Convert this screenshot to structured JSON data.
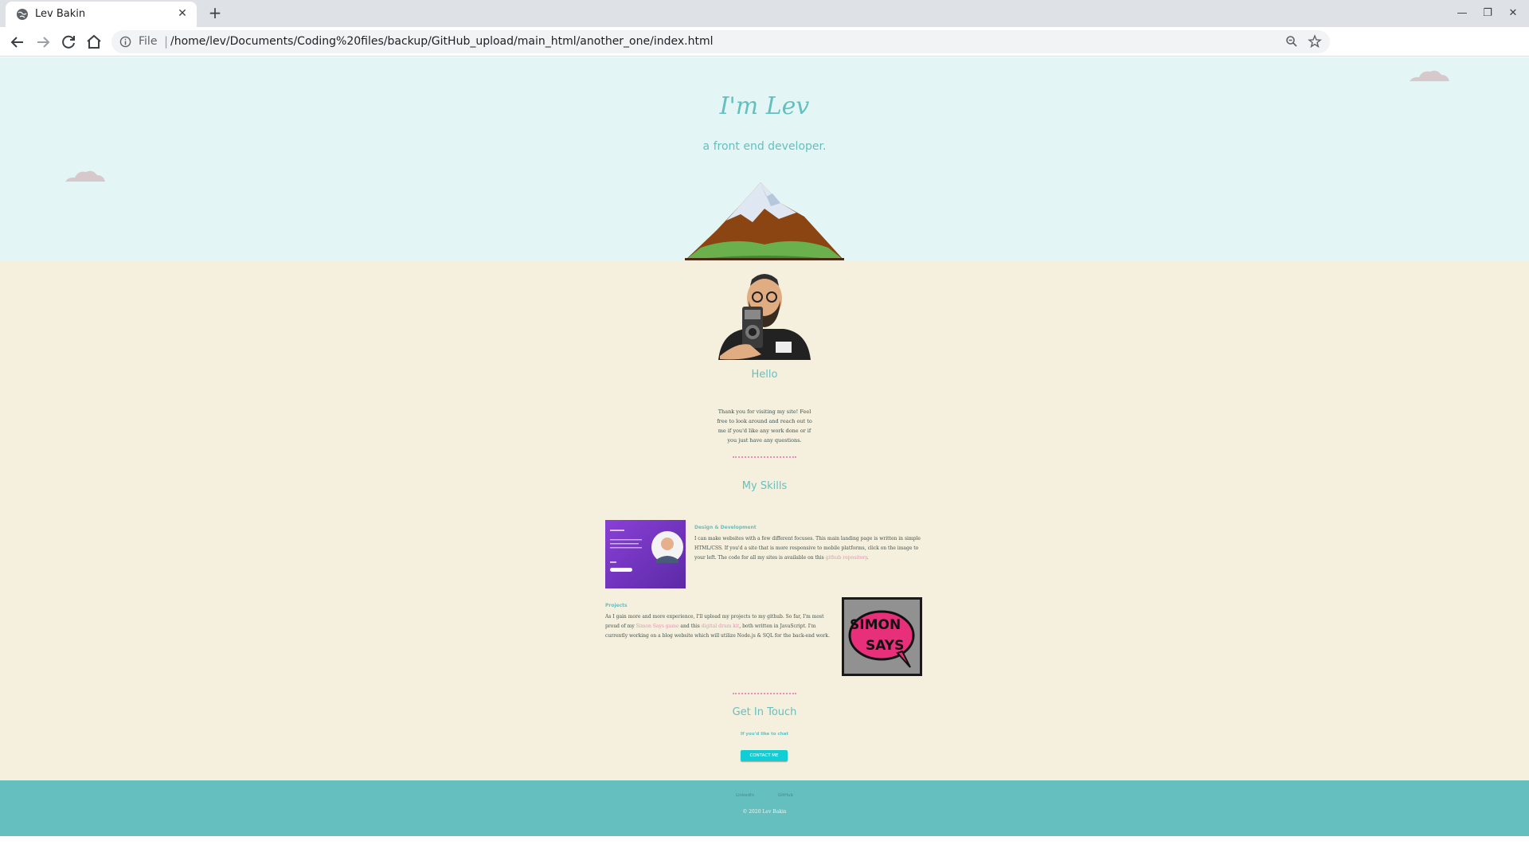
{
  "browser": {
    "tab_title": "Lev Bakin",
    "scheme_label": "File",
    "url": "/home/lev/Documents/Coding%20files/backup/GitHub_upload/main_html/another_one/index.html"
  },
  "hero": {
    "title": "I'm Lev",
    "subtitle": "a front end developer."
  },
  "intro": {
    "heading": "Hello",
    "text": "Thank you for visiting my site! Feel free to look around and reach out to me if you'd like any work done or if you just have any questions."
  },
  "skills": {
    "heading": "My Skills",
    "design": {
      "title": "Design & Development",
      "text_before": "I can make websites with a few different focuses. This main landing page is written in simple HTML/CSS. If you'd a site that is more responsive to mobile platforms, click on the image to your left. The code for all my sites is available on this ",
      "link": "github repository",
      "text_after": "."
    },
    "projects": {
      "title": "Projects",
      "text_1": "As I gain more and more experience, I'll upload my projects to my github. So far, I'm most proud of my ",
      "link_1": "Simon Says game",
      "text_2": " and this ",
      "link_2": "digital drum kit",
      "text_3": ", both written in JavaScript. I'm currently working on a blog website which will utilize Node.js & SQL for the back-end work."
    }
  },
  "contact": {
    "heading": "Get In Touch",
    "subtext": "If you'd like to chat",
    "button": "CONTACT ME"
  },
  "footer": {
    "links": [
      "LinkedIn",
      "GitHub"
    ],
    "copyright": "© 2020 Lev Bakin"
  },
  "colors": {
    "sky": "#e3f6f5",
    "content_bg": "#f4f0dd",
    "accent": "#66bfbf",
    "link_pink": "#ea8fb7",
    "button": "#11cdd4"
  }
}
